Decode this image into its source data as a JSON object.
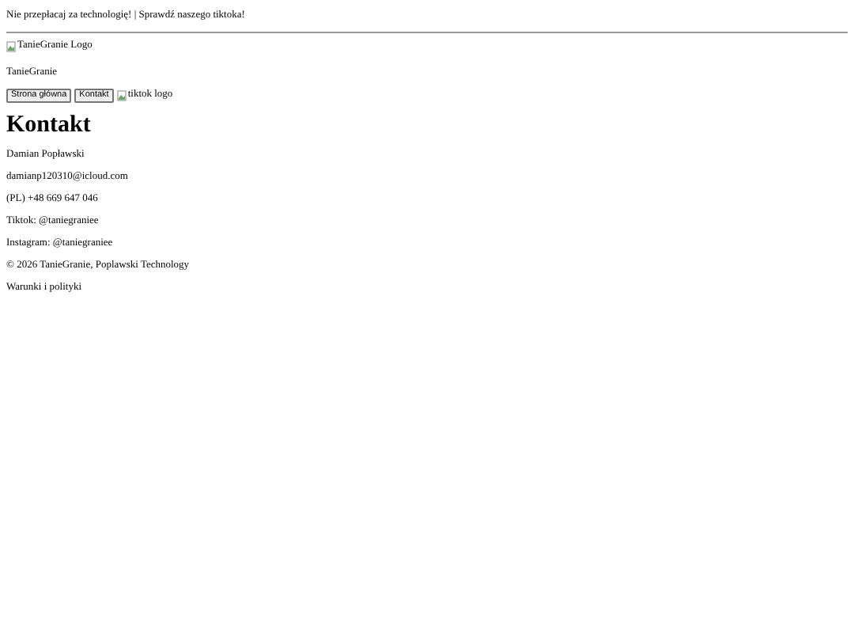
{
  "banner": "Nie przepłacaj za technologię! | Sprawdź naszego tiktoka!",
  "logo": {
    "alt": "TanieGranie Logo"
  },
  "site_name": "TanieGranie",
  "nav": [
    {
      "kind": "button",
      "label": "Strona główna"
    },
    {
      "kind": "button",
      "label": "Kontakt"
    },
    {
      "kind": "image",
      "label": "tiktok logo"
    }
  ],
  "heading": "Kontakt",
  "contact_lines": [
    "Damian Popławski",
    "damianp120310@icloud.com",
    "(PL) +48 669 647 046",
    "Tiktok: @taniegraniee",
    "Instagram: @taniegraniee"
  ],
  "footer": [
    "© 2026 TanieGranie, Poplawski Technology",
    "Warunki i polityki"
  ]
}
